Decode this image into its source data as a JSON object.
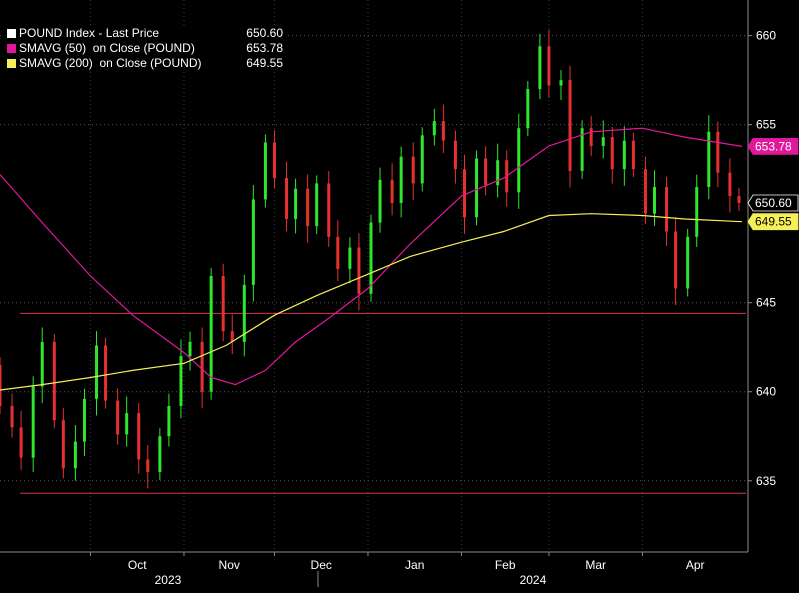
{
  "legend": [
    {
      "name": "POUND Index - Last Price",
      "value": "650.60",
      "color": "#ffffff"
    },
    {
      "name": "SMAVG (50)  on Close (POUND)",
      "value": "653.78",
      "color": "#e0189a"
    },
    {
      "name": "SMAVG (200)  on Close (POUND)",
      "value": "649.55",
      "color": "#f5f05a"
    }
  ],
  "chart_data": {
    "type": "candlestick",
    "title": "",
    "xlabel": "",
    "ylabel": "",
    "ylim": [
      631,
      662
    ],
    "y_ticks": [
      "660",
      "655",
      "645",
      "640",
      "635"
    ],
    "x_ticks": [
      {
        "label": "Oct",
        "date": "2023-10-01"
      },
      {
        "label": "Nov",
        "date": "2023-11-01"
      },
      {
        "label": "Dec",
        "date": "2023-12-01"
      },
      {
        "label": "Jan",
        "date": "2024-01-01"
      },
      {
        "label": "Feb",
        "date": "2024-02-01"
      },
      {
        "label": "Mar",
        "date": "2024-03-01"
      },
      {
        "label": "Apr",
        "date": "2024-04-01"
      }
    ],
    "year_labels": [
      {
        "label": "2023",
        "date": "2023-11-01"
      },
      {
        "label": "2024",
        "date": "2024-03-01"
      }
    ],
    "x_range": [
      "2023-09-01",
      "2024-05-06"
    ],
    "support_levels": [
      644.4,
      634.3
    ],
    "last_price_tags": [
      {
        "label": "653.78",
        "value": 653.78,
        "bg": "#e0189a",
        "fg": "#ffffff"
      },
      {
        "label": "650.60",
        "value": 650.6,
        "bg": "#000000",
        "fg": "#ffffff"
      },
      {
        "label": "649.55",
        "value": 649.55,
        "bg": "#f5f05a",
        "fg": "#000000"
      }
    ],
    "series": [
      {
        "name": "POUND Index - Last Price",
        "kind": "candles",
        "up_color": "#2ee62e",
        "down_color": "#e83030",
        "closes": [
          {
            "date": "2023-09-01",
            "value": 639.2
          },
          {
            "date": "2023-09-05",
            "value": 638.0
          },
          {
            "date": "2023-09-08",
            "value": 636.3
          },
          {
            "date": "2023-09-12",
            "value": 640.3
          },
          {
            "date": "2023-09-15",
            "value": 642.8
          },
          {
            "date": "2023-09-19",
            "value": 638.4
          },
          {
            "date": "2023-09-22",
            "value": 635.7
          },
          {
            "date": "2023-09-26",
            "value": 637.2
          },
          {
            "date": "2023-09-29",
            "value": 639.6
          },
          {
            "date": "2023-10-03",
            "value": 642.6
          },
          {
            "date": "2023-10-06",
            "value": 639.5
          },
          {
            "date": "2023-10-10",
            "value": 637.6
          },
          {
            "date": "2023-10-13",
            "value": 638.8
          },
          {
            "date": "2023-10-17",
            "value": 636.2
          },
          {
            "date": "2023-10-20",
            "value": 635.5
          },
          {
            "date": "2023-10-24",
            "value": 637.5
          },
          {
            "date": "2023-10-27",
            "value": 639.2
          },
          {
            "date": "2023-10-31",
            "value": 642.0
          },
          {
            "date": "2023-11-03",
            "value": 642.8
          },
          {
            "date": "2023-11-07",
            "value": 640.0
          },
          {
            "date": "2023-11-10",
            "value": 646.5
          },
          {
            "date": "2023-11-14",
            "value": 643.4
          },
          {
            "date": "2023-11-17",
            "value": 642.8
          },
          {
            "date": "2023-11-21",
            "value": 646.0
          },
          {
            "date": "2023-11-24",
            "value": 650.8
          },
          {
            "date": "2023-11-28",
            "value": 654.0
          },
          {
            "date": "2023-12-01",
            "value": 652.0
          },
          {
            "date": "2023-12-05",
            "value": 649.7
          },
          {
            "date": "2023-12-08",
            "value": 651.4
          },
          {
            "date": "2023-12-12",
            "value": 649.3
          },
          {
            "date": "2023-12-15",
            "value": 651.7
          },
          {
            "date": "2023-12-19",
            "value": 648.7
          },
          {
            "date": "2023-12-22",
            "value": 646.9
          },
          {
            "date": "2023-12-26",
            "value": 648.1
          },
          {
            "date": "2023-12-29",
            "value": 645.5
          },
          {
            "date": "2024-01-02",
            "value": 649.5
          },
          {
            "date": "2024-01-05",
            "value": 651.9
          },
          {
            "date": "2024-01-09",
            "value": 650.6
          },
          {
            "date": "2024-01-12",
            "value": 653.2
          },
          {
            "date": "2024-01-16",
            "value": 651.7
          },
          {
            "date": "2024-01-19",
            "value": 654.4
          },
          {
            "date": "2024-01-23",
            "value": 655.2
          },
          {
            "date": "2024-01-26",
            "value": 654.1
          },
          {
            "date": "2024-01-30",
            "value": 652.5
          },
          {
            "date": "2024-02-02",
            "value": 649.8
          },
          {
            "date": "2024-02-06",
            "value": 653.1
          },
          {
            "date": "2024-02-09",
            "value": 651.6
          },
          {
            "date": "2024-02-13",
            "value": 653.0
          },
          {
            "date": "2024-02-16",
            "value": 651.2
          },
          {
            "date": "2024-02-20",
            "value": 654.8
          },
          {
            "date": "2024-02-23",
            "value": 657.0
          },
          {
            "date": "2024-02-27",
            "value": 659.4
          },
          {
            "date": "2024-03-01",
            "value": 657.2
          },
          {
            "date": "2024-03-05",
            "value": 657.5
          },
          {
            "date": "2024-03-08",
            "value": 652.4
          },
          {
            "date": "2024-03-12",
            "value": 654.8
          },
          {
            "date": "2024-03-15",
            "value": 653.8
          },
          {
            "date": "2024-03-19",
            "value": 654.3
          },
          {
            "date": "2024-03-22",
            "value": 652.5
          },
          {
            "date": "2024-03-26",
            "value": 654.1
          },
          {
            "date": "2024-03-29",
            "value": 652.5
          },
          {
            "date": "2024-04-02",
            "value": 650.0
          },
          {
            "date": "2024-04-05",
            "value": 651.5
          },
          {
            "date": "2024-04-09",
            "value": 649.0
          },
          {
            "date": "2024-04-12",
            "value": 645.8
          },
          {
            "date": "2024-04-16",
            "value": 648.7
          },
          {
            "date": "2024-04-19",
            "value": 651.5
          },
          {
            "date": "2024-04-23",
            "value": 654.6
          },
          {
            "date": "2024-04-26",
            "value": 652.3
          },
          {
            "date": "2024-04-30",
            "value": 651.0
          },
          {
            "date": "2024-05-03",
            "value": 650.6
          }
        ]
      },
      {
        "name": "SMAVG (50)  on Close (POUND)",
        "kind": "line",
        "color": "#e0189a",
        "points": [
          {
            "date": "2023-09-01",
            "value": 652.2
          },
          {
            "date": "2023-09-15",
            "value": 649.5
          },
          {
            "date": "2023-10-01",
            "value": 646.5
          },
          {
            "date": "2023-10-15",
            "value": 644.3
          },
          {
            "date": "2023-11-01",
            "value": 642.2
          },
          {
            "date": "2023-11-10",
            "value": 640.8
          },
          {
            "date": "2023-11-18",
            "value": 640.4
          },
          {
            "date": "2023-11-28",
            "value": 641.2
          },
          {
            "date": "2023-12-08",
            "value": 642.8
          },
          {
            "date": "2023-12-18",
            "value": 644.0
          },
          {
            "date": "2024-01-01",
            "value": 645.8
          },
          {
            "date": "2024-01-15",
            "value": 648.3
          },
          {
            "date": "2024-02-01",
            "value": 651.0
          },
          {
            "date": "2024-02-15",
            "value": 652.0
          },
          {
            "date": "2024-03-01",
            "value": 653.8
          },
          {
            "date": "2024-03-15",
            "value": 654.6
          },
          {
            "date": "2024-04-01",
            "value": 654.8
          },
          {
            "date": "2024-04-15",
            "value": 654.3
          },
          {
            "date": "2024-05-04",
            "value": 653.78
          }
        ]
      },
      {
        "name": "SMAVG (200)  on Close (POUND)",
        "kind": "line",
        "color": "#f5f05a",
        "points": [
          {
            "date": "2023-09-01",
            "value": 640.1
          },
          {
            "date": "2023-09-15",
            "value": 640.4
          },
          {
            "date": "2023-10-01",
            "value": 640.8
          },
          {
            "date": "2023-10-15",
            "value": 641.2
          },
          {
            "date": "2023-11-01",
            "value": 641.6
          },
          {
            "date": "2023-11-15",
            "value": 642.6
          },
          {
            "date": "2023-12-01",
            "value": 644.3
          },
          {
            "date": "2023-12-15",
            "value": 645.4
          },
          {
            "date": "2024-01-01",
            "value": 646.6
          },
          {
            "date": "2024-01-15",
            "value": 647.6
          },
          {
            "date": "2024-02-01",
            "value": 648.4
          },
          {
            "date": "2024-02-15",
            "value": 649.0
          },
          {
            "date": "2024-03-01",
            "value": 649.9
          },
          {
            "date": "2024-03-15",
            "value": 650.0
          },
          {
            "date": "2024-04-01",
            "value": 649.9
          },
          {
            "date": "2024-04-15",
            "value": 649.7
          },
          {
            "date": "2024-05-04",
            "value": 649.55
          }
        ]
      }
    ]
  }
}
